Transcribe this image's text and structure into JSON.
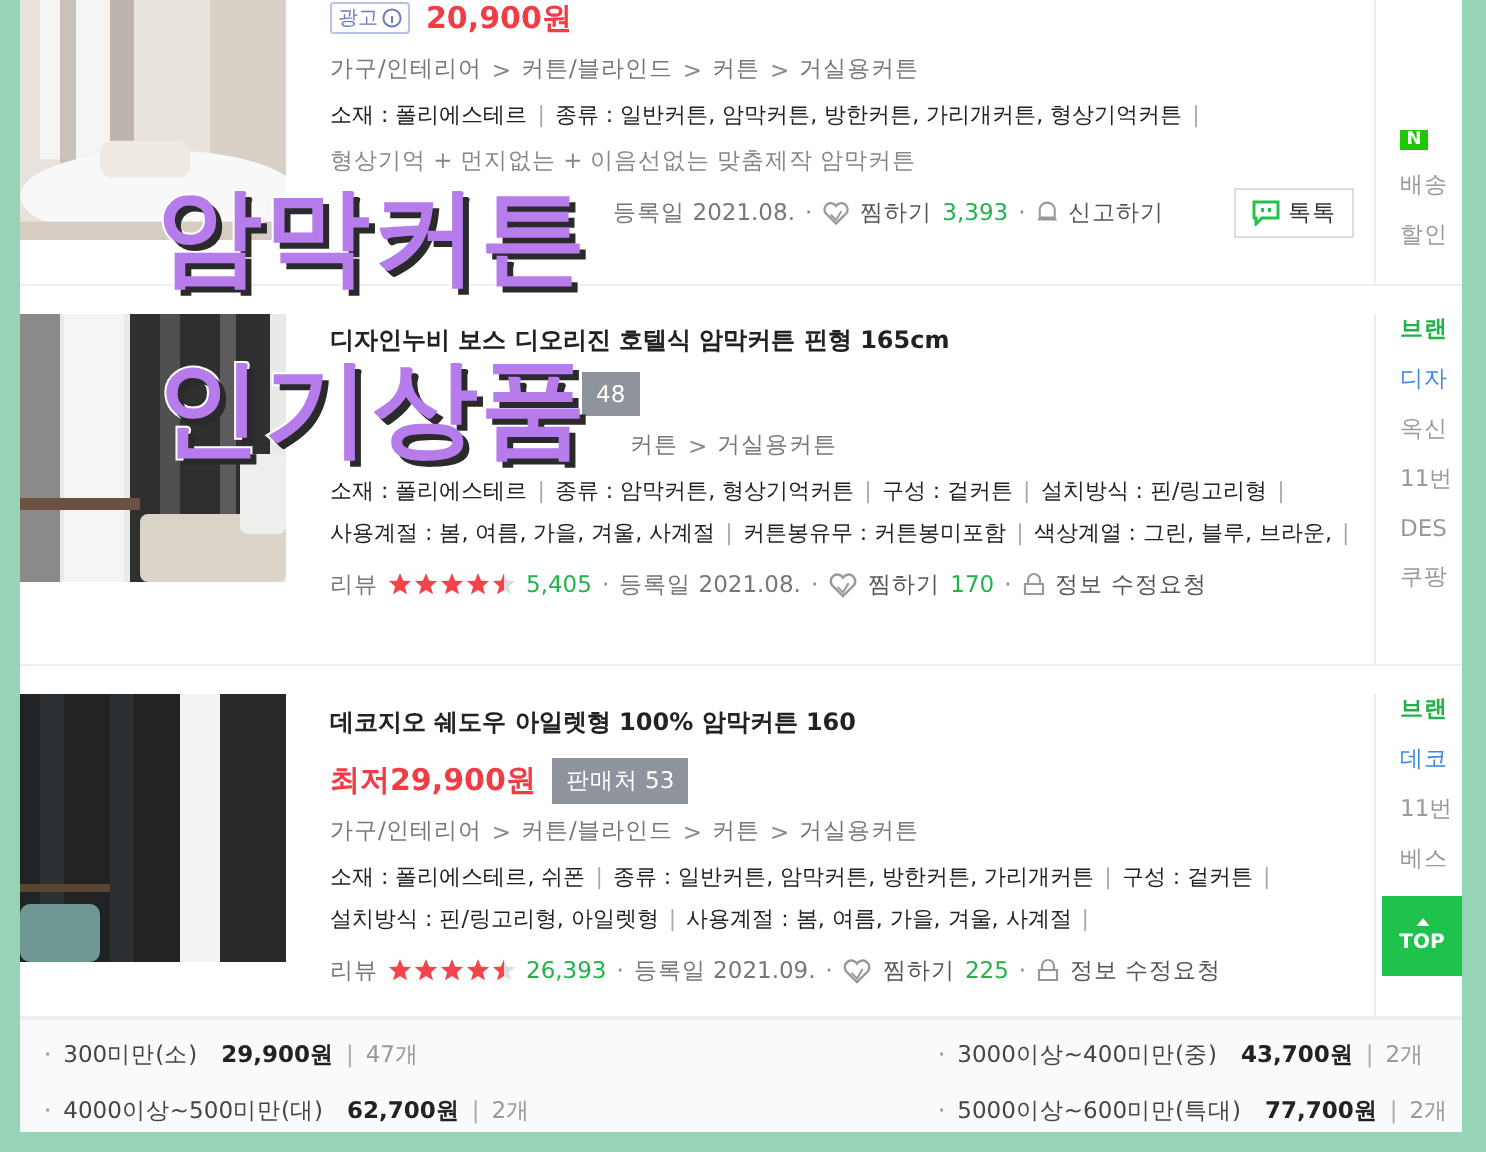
{
  "overlay_title": [
    "암막커튼",
    "인기상품"
  ],
  "separators": {
    "breadcrumb": ">",
    "spec": "|",
    "meta": "·",
    "bullet": "·",
    "count": "|"
  },
  "products": [
    {
      "ad_badge": "광고",
      "price": "20,900원",
      "breadcrumb": [
        "가구/인테리어",
        "커튼/블라인드",
        "커튼",
        "거실용커튼"
      ],
      "specs": [
        [
          "소재 : 폴리에스테르",
          "종류 : 일반커튼, 암막커튼, 방한커튼, 가리개커튼, 형상기억커튼"
        ]
      ],
      "description": "형상기억 + 먼지없는 + 이음선없는 맞춤제작 암막커튼",
      "registered": "등록일 2021.08.",
      "wish": {
        "label": "찜하기",
        "count": "3,393"
      },
      "action": {
        "kind": "report",
        "label": "신고하기"
      },
      "talk_button": "톡톡",
      "side": [
        {
          "kind": "npay",
          "text": "N"
        },
        {
          "kind": "gray",
          "text": "배송"
        },
        {
          "kind": "gray",
          "text": "할인"
        }
      ]
    },
    {
      "title": "디자인누비 보스 디오리진 호텔식 암막커튼 핀형 165cm",
      "seller_count": "48",
      "breadcrumb": [
        "커튼",
        "거실용커튼"
      ],
      "specs": [
        [
          "소재 : 폴리에스테르",
          "종류 : 암막커튼, 형상기억커튼",
          "구성 : 겉커튼",
          "설치방식 : 핀/링고리형"
        ],
        [
          "사용계절 : 봄, 여름, 가을, 겨울, 사계절",
          "커튼봉유무 : 커튼봉미포함",
          "색상계열 : 그린, 블루, 브라운,"
        ]
      ],
      "review": {
        "label": "리뷰",
        "stars": 4.5,
        "count": "5,405"
      },
      "registered": "등록일 2021.08.",
      "wish": {
        "label": "찜하기",
        "count": "170"
      },
      "action": {
        "kind": "edit",
        "label": "정보 수정요청"
      },
      "side": [
        {
          "kind": "green",
          "text": "브랜"
        },
        {
          "kind": "blue",
          "text": "디자"
        },
        {
          "kind": "gray",
          "text": "옥신"
        },
        {
          "kind": "gray",
          "text": "11번"
        },
        {
          "kind": "gray",
          "text": "DES"
        },
        {
          "kind": "gray",
          "text": "쿠팡"
        }
      ]
    },
    {
      "title": "데코지오 쉐도우 아일렛형 100% 암막커튼 160",
      "price": "최저29,900원",
      "seller_count": "판매처 53",
      "breadcrumb": [
        "가구/인테리어",
        "커튼/블라인드",
        "커튼",
        "거실용커튼"
      ],
      "specs": [
        [
          "소재 : 폴리에스테르, 쉬폰",
          "종류 : 일반커튼, 암막커튼, 방한커튼, 가리개커튼",
          "구성 : 겉커튼"
        ],
        [
          "설치방식 : 핀/링고리형, 아일렛형",
          "사용계절 : 봄, 여름, 가을, 겨울, 사계절"
        ]
      ],
      "review": {
        "label": "리뷰",
        "stars": 4.5,
        "count": "26,393"
      },
      "registered": "등록일 2021.09.",
      "wish": {
        "label": "찜하기",
        "count": "225"
      },
      "action": {
        "kind": "edit",
        "label": "정보 수정요청"
      },
      "side": [
        {
          "kind": "green",
          "text": "브랜"
        },
        {
          "kind": "blue",
          "text": "데코"
        },
        {
          "kind": "gray",
          "text": "11번"
        },
        {
          "kind": "gray",
          "text": "베스"
        }
      ]
    }
  ],
  "top_button": "TOP",
  "size_prices": [
    {
      "size": "300미만(소)",
      "price": "29,900원",
      "count": "47개"
    },
    {
      "size": "3000이상~400미만(중)",
      "price": "43,700원",
      "count": "2개"
    },
    {
      "size": "4000이상~500미만(대)",
      "price": "62,700원",
      "count": "2개"
    },
    {
      "size": "5000이상~600미만(특대)",
      "price": "77,700원",
      "count": "2개"
    }
  ]
}
